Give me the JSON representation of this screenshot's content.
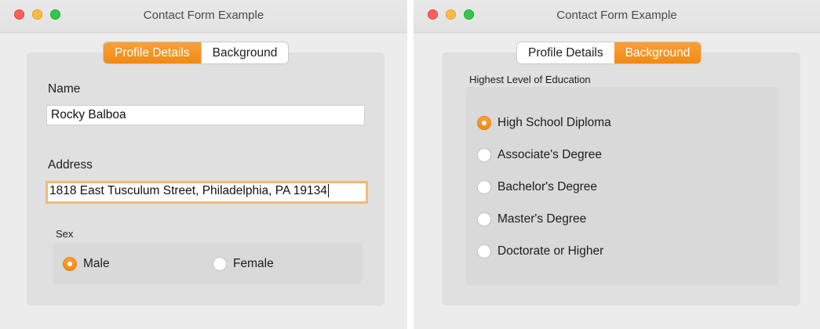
{
  "colors": {
    "accent": "#f5921e",
    "window_bg": "#ececec",
    "panel_bg": "#e0e0e0"
  },
  "windows": [
    {
      "title": "Contact Form Example",
      "tabs": [
        {
          "label": "Profile Details",
          "active": true
        },
        {
          "label": "Background",
          "active": false
        }
      ],
      "profile": {
        "name_label": "Name",
        "name_value": "Rocky Balboa",
        "address_label": "Address",
        "address_value": "1818 East Tusculum Street, Philadelphia, PA 19134",
        "sex_label": "Sex",
        "sex_options": [
          {
            "label": "Male",
            "selected": true
          },
          {
            "label": "Female",
            "selected": false
          }
        ]
      }
    },
    {
      "title": "Contact Form Example",
      "tabs": [
        {
          "label": "Profile Details",
          "active": false
        },
        {
          "label": "Background",
          "active": true
        }
      ],
      "background": {
        "education_label": "Highest Level of Education",
        "education_options": [
          {
            "label": "High School Diploma",
            "selected": true
          },
          {
            "label": "Associate's Degree",
            "selected": false
          },
          {
            "label": "Bachelor's Degree",
            "selected": false
          },
          {
            "label": "Master's Degree",
            "selected": false
          },
          {
            "label": "Doctorate or Higher",
            "selected": false
          }
        ]
      }
    }
  ]
}
